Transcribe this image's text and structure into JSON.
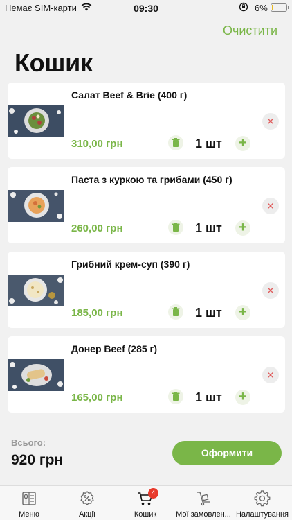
{
  "status_bar": {
    "carrier": "Немає SIM-карти",
    "time": "09:30",
    "battery": "6%",
    "battery_level": 0.06
  },
  "header": {
    "clear_label": "Очистити",
    "title": "Кошик"
  },
  "cart": {
    "items": [
      {
        "name": "Салат Beef & Brie (400 г)",
        "price": "310,00 грн",
        "qty": "1 шт",
        "image": "salad-photo"
      },
      {
        "name": "Паста з куркою та грибами  (450 г)",
        "price": "260,00 грн",
        "qty": "1 шт",
        "image": "pasta-photo"
      },
      {
        "name": "Грибний крем-суп (390 г)",
        "price": "185,00 грн",
        "qty": "1 шт",
        "image": "soup-photo"
      },
      {
        "name": "Донер Beef (285 г)",
        "price": "165,00 грн",
        "qty": "1 шт",
        "image": "doner-photo"
      }
    ]
  },
  "summary": {
    "total_label": "Всього:",
    "total_value": "920 грн",
    "checkout_label": "Оформити"
  },
  "tabbar": {
    "tabs": [
      {
        "label": "Меню",
        "icon": "menu-book-icon"
      },
      {
        "label": "Акції",
        "icon": "discount-badge-icon"
      },
      {
        "label": "Кошик",
        "icon": "cart-icon",
        "badge": "4"
      },
      {
        "label": "Мої замовлення",
        "label_shown": "Мої замовлен...",
        "icon": "orders-trolley-icon"
      },
      {
        "label": "Налаштування",
        "icon": "gear-icon"
      }
    ]
  },
  "colors": {
    "accent": "#7ab648",
    "badge": "#e8392b",
    "remove": "#e05c5c",
    "background": "#f1f1f1"
  }
}
